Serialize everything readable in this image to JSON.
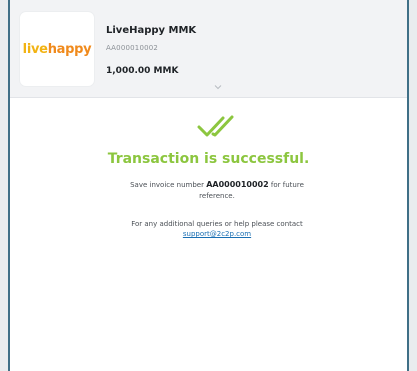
{
  "merchant": {
    "logo_live": "live",
    "logo_happy": "happy",
    "name": "LiveHappy MMK",
    "invoice_small": "AA000010002",
    "amount": "1,000.00 MMK"
  },
  "result": {
    "title": "Transaction is successful.",
    "save_prefix": "Save invoice number ",
    "invoice_number": "AA000010002",
    "save_suffix": " for future reference.",
    "help_prefix": "For any additional queries or help please contact ",
    "support_email": "support@2c2p.com"
  },
  "colors": {
    "success_green": "#8cc63f",
    "link_blue": "#1a6fb3",
    "logo_yellow": "#f2b313",
    "logo_orange": "#f08a1c"
  },
  "icons": {
    "check": "double-check-icon",
    "expand": "chevron-down-icon"
  }
}
